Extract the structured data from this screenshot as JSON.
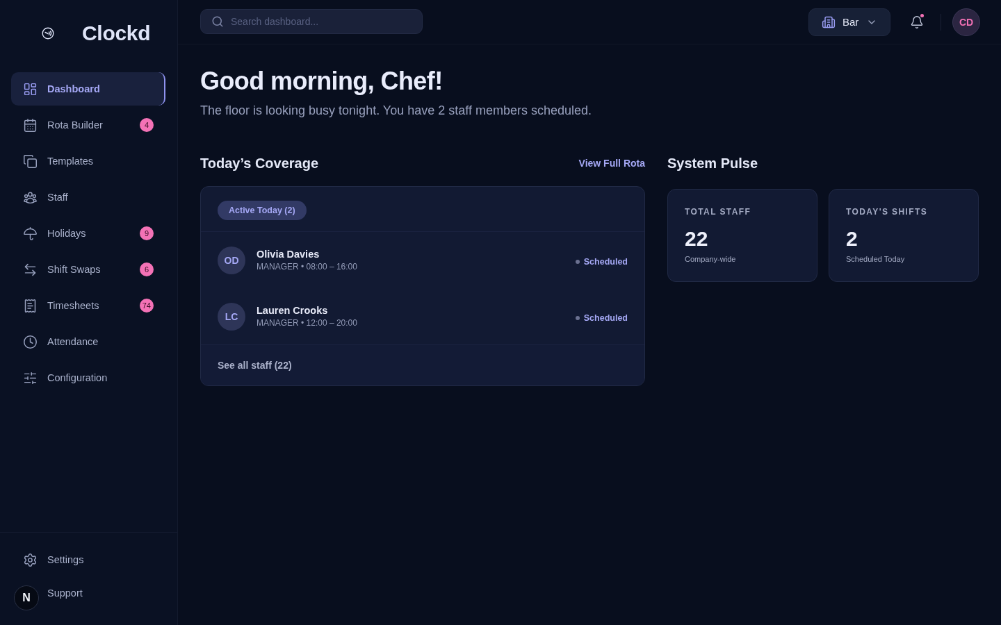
{
  "sidebar": {
    "brand": {
      "name": "Clockd"
    },
    "nav_items": [
      {
        "label": "Dashboard",
        "selected": true
      },
      {
        "label": "Rota Builder",
        "selected": false,
        "badge": "4"
      },
      {
        "label": "Templates",
        "selected": false
      },
      {
        "label": "Staff",
        "selected": false
      },
      {
        "label": "Holidays",
        "selected": false,
        "badge": "9"
      },
      {
        "label": "Shift Swaps",
        "selected": false,
        "badge": "6"
      },
      {
        "label": "Timesheets",
        "selected": false,
        "badge": "74"
      },
      {
        "label": "Attendance",
        "selected": false
      },
      {
        "label": "Configuration",
        "selected": false
      }
    ],
    "footer_items": [
      {
        "label": "Settings"
      },
      {
        "label": "Support"
      }
    ]
  },
  "dev_indicator": {
    "label": "N"
  },
  "header": {
    "search": {
      "placeholder": "Search dashboard..."
    },
    "location": {
      "value": "Bar"
    },
    "notifications": {
      "unread": true
    },
    "user": {
      "initials": "CD"
    }
  },
  "greeting": {
    "title": "Good morning, Chef!",
    "subtitle": "The floor is looking busy tonight. You have 2 staff members scheduled."
  },
  "coverage": {
    "title": "Today’s Coverage",
    "link": "View Full Rota",
    "filter": "Active Today (2)",
    "staff": [
      {
        "initials": "OD",
        "name": "Olivia Davies",
        "meta": "MANAGER • 08:00 – 16:00",
        "status": "Scheduled"
      },
      {
        "initials": "LC",
        "name": "Lauren Crooks",
        "meta": "MANAGER • 12:00 – 20:00",
        "status": "Scheduled"
      }
    ],
    "footer_link": "See all staff (22)"
  },
  "pulse": {
    "title": "System Pulse",
    "stats": [
      {
        "label": "TOTAL STAFF",
        "value": "22",
        "caption": "Company-wide"
      },
      {
        "label": "TODAY'S SHIFTS",
        "value": "2",
        "caption": "Scheduled Today"
      }
    ]
  }
}
